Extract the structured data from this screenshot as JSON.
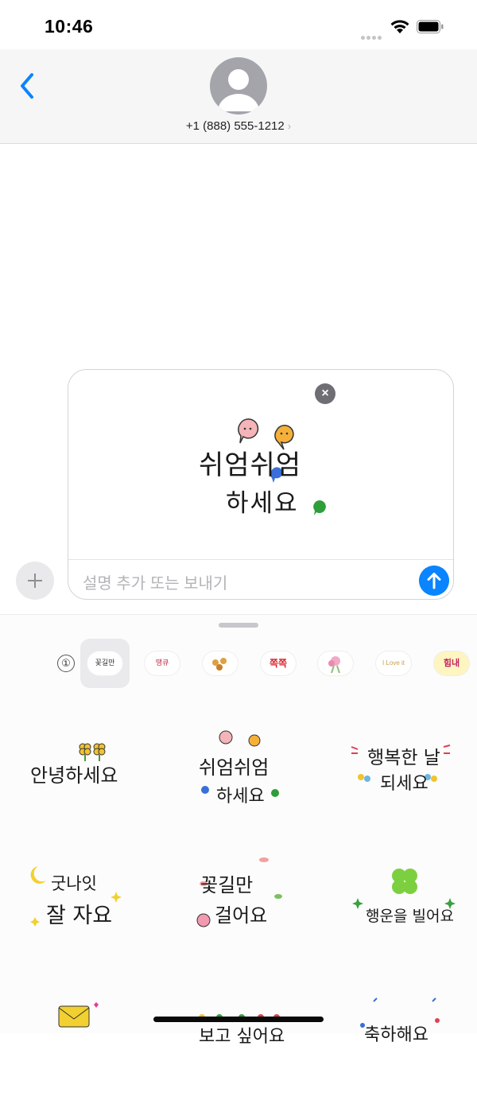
{
  "status_bar": {
    "time": "10:46"
  },
  "header": {
    "contact": "+1 (888) 555-1212",
    "chevron": "›"
  },
  "composer": {
    "placeholder": "설명 추가 또는 보내기",
    "remove": "×",
    "preview_sticker": {
      "line1": "쉬엄쉬엄",
      "line2": "하세요"
    }
  },
  "drawer": {
    "tabs": [
      {
        "label": "①"
      },
      {
        "label": "꽃길만"
      },
      {
        "label": "땡큐"
      },
      {
        "label": ""
      },
      {
        "label": "쪽쪽"
      },
      {
        "label": ""
      },
      {
        "label": "I Love it"
      },
      {
        "label": "힘내"
      }
    ],
    "stickers": [
      {
        "lines": [
          "안녕하세요"
        ]
      },
      {
        "lines": [
          "쉬엄쉬엄",
          "하세요"
        ]
      },
      {
        "lines": [
          "행복한 날",
          "되세요"
        ]
      },
      {
        "lines": [
          "굿나잇",
          "잘 자요"
        ]
      },
      {
        "lines": [
          "꽃길만",
          "걸어요"
        ]
      },
      {
        "lines": [
          "행운을 빌어요"
        ]
      },
      {
        "lines": [
          ""
        ]
      },
      {
        "lines": [
          "보고 싶어요"
        ]
      },
      {
        "lines": [
          "축하해요"
        ]
      }
    ]
  },
  "colors": {
    "accent": "#0a84ff",
    "avatar": "#a3a5ab"
  }
}
